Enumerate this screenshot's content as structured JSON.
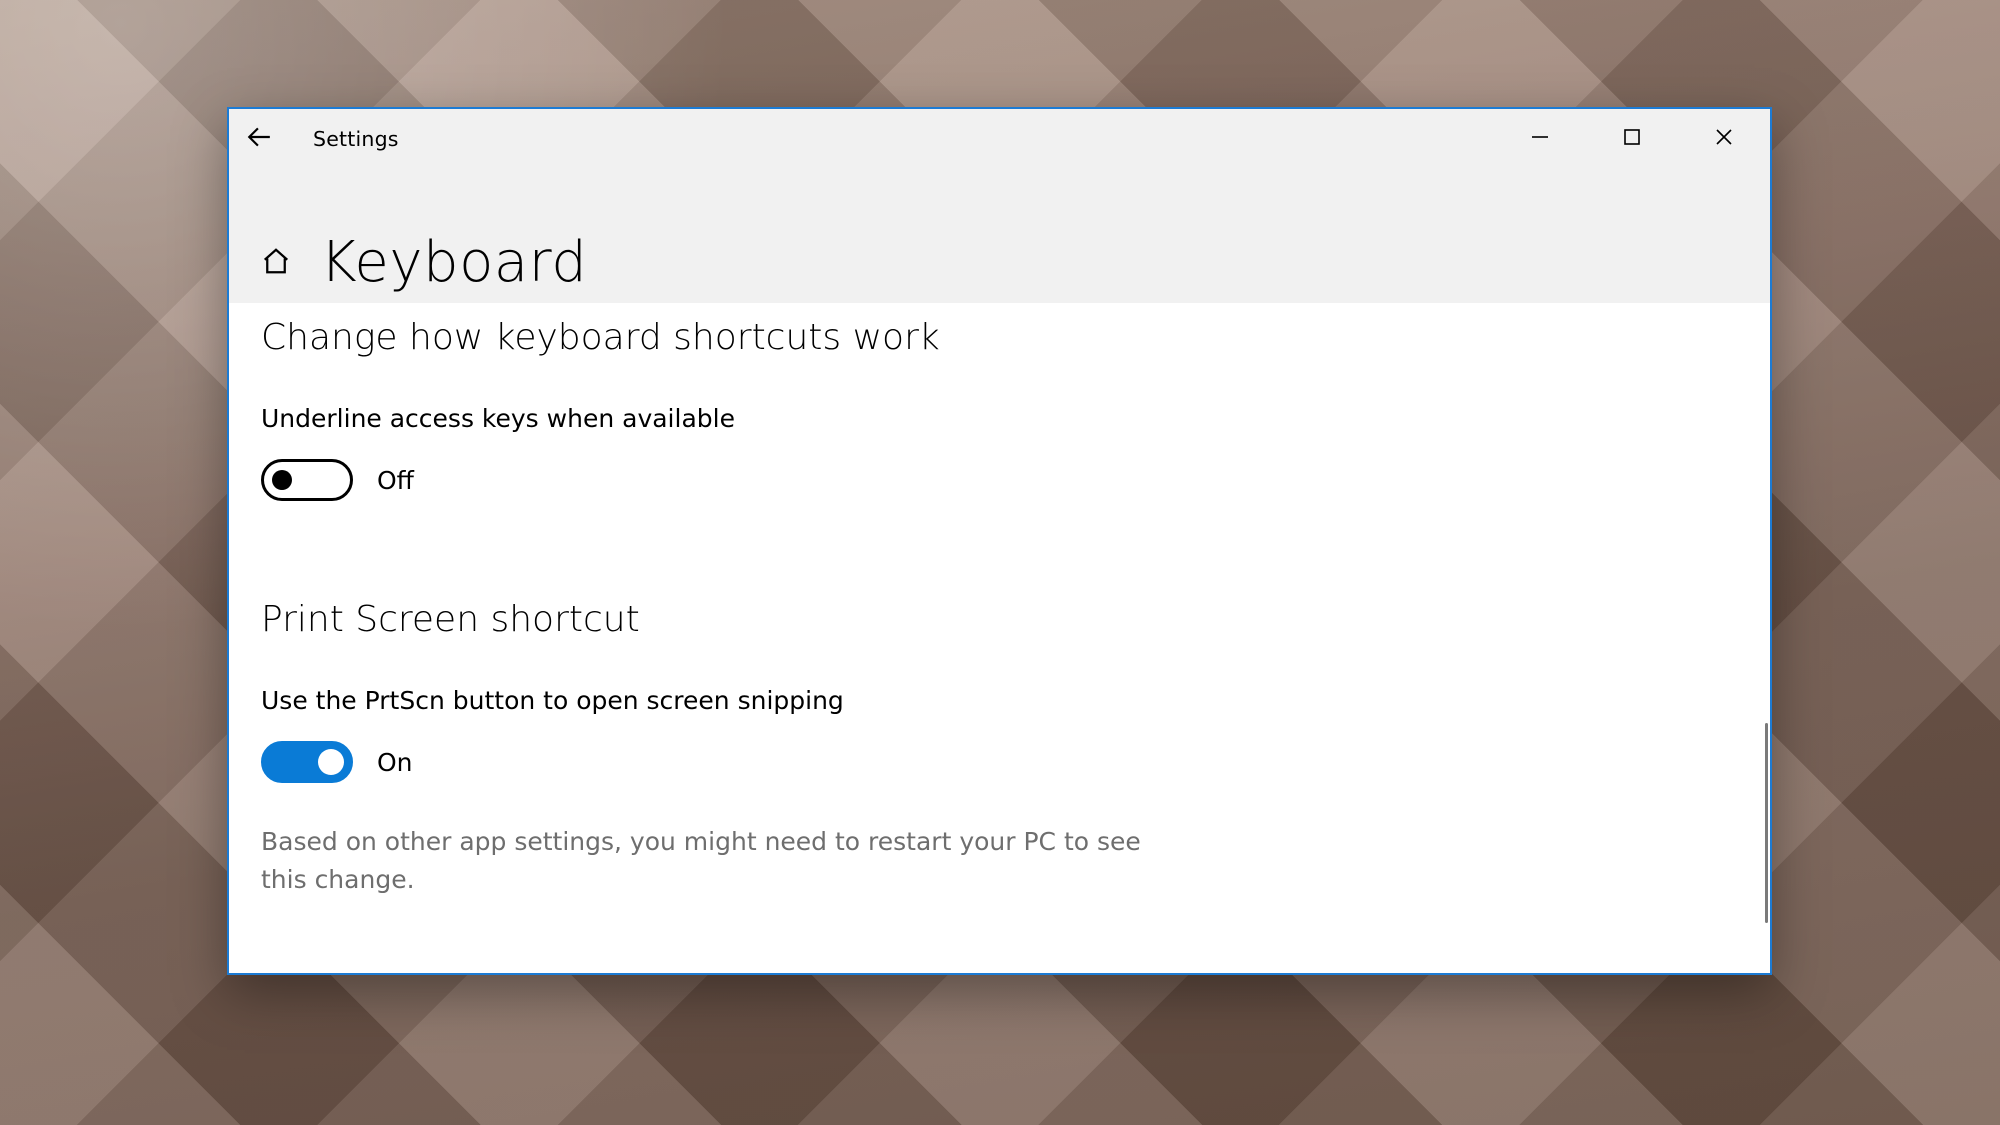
{
  "app": {
    "title": "Settings"
  },
  "page": {
    "title": "Keyboard"
  },
  "sections": {
    "shortcuts": {
      "heading": "Change how keyboard shortcuts work",
      "underline": {
        "label": "Underline access keys when available",
        "state_label": "Off",
        "value": false
      }
    },
    "printscreen": {
      "heading": "Print Screen shortcut",
      "prtscn": {
        "label": "Use the PrtScn button to open screen snipping",
        "state_label": "On",
        "value": true
      },
      "note": "Based on other app settings, you might need to restart your PC to see this change."
    }
  },
  "colors": {
    "accent": "#0a7bd6",
    "window_border": "#1c7bd4"
  }
}
